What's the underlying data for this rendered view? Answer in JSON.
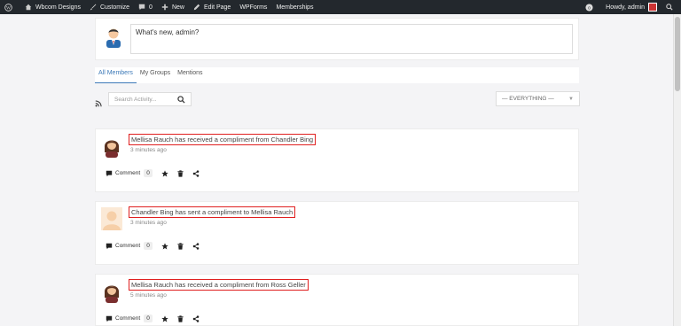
{
  "adminbar": {
    "items": [
      {
        "label": "Wbcom Designs"
      },
      {
        "label": "Customize"
      },
      {
        "label": "0"
      },
      {
        "label": "New"
      },
      {
        "label": "Edit Page"
      },
      {
        "label": "WPForms"
      },
      {
        "label": "Memberships"
      }
    ],
    "howdy": "Howdy, admin"
  },
  "post_form": {
    "placeholder": "What's new, admin?"
  },
  "tabs": [
    {
      "label": "All Members"
    },
    {
      "label": "My Groups"
    },
    {
      "label": "Mentions"
    }
  ],
  "search": {
    "placeholder": "Search Activity..."
  },
  "filter": {
    "selected": "— EVERYTHING —"
  },
  "activities": [
    {
      "text": "Mellisa Rauch has received a compliment from Chandler Bing",
      "time": "3 minutes ago",
      "comment_label": "Comment",
      "comment_count": "0",
      "avatar": "female-avatar"
    },
    {
      "text": "Chandler Bing has sent a compliment to Mellisa Rauch",
      "time": "3 minutes ago",
      "comment_label": "Comment",
      "comment_count": "0",
      "avatar": "default-avatar"
    },
    {
      "text": "Mellisa Rauch has received a compliment from Ross Geller",
      "time": "5 minutes ago",
      "comment_label": "Comment",
      "comment_count": "0",
      "avatar": "female-avatar"
    }
  ],
  "colors": {
    "accent": "#3d7ab8",
    "highlight": "#e02020",
    "adminbar": "#23282d"
  }
}
